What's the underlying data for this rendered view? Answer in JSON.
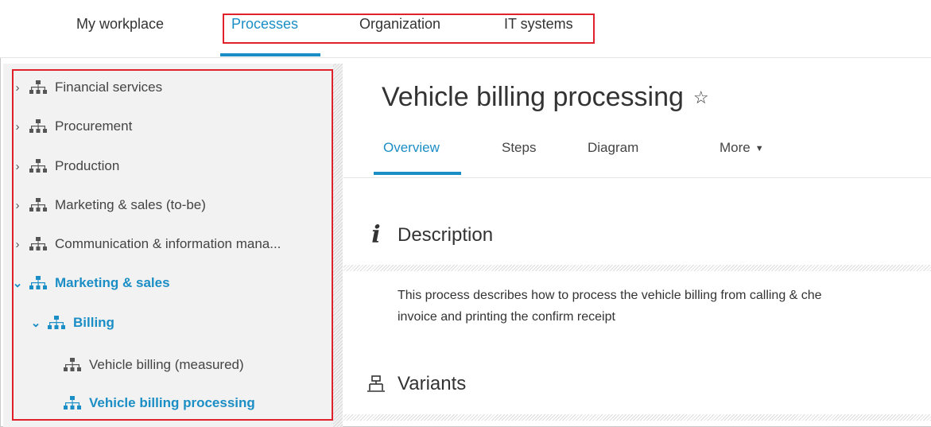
{
  "topnav": {
    "tabs": [
      "My workplace",
      "Processes",
      "Organization",
      "IT systems"
    ],
    "active": "Processes"
  },
  "sidebar": {
    "items": [
      {
        "label": "Financial services",
        "expanded": false
      },
      {
        "label": "Procurement",
        "expanded": false
      },
      {
        "label": "Production",
        "expanded": false
      },
      {
        "label": "Marketing & sales (to-be)",
        "expanded": false
      },
      {
        "label": "Communication & information mana...",
        "expanded": false
      },
      {
        "label": "Marketing & sales",
        "expanded": true
      },
      {
        "label": "Billing",
        "expanded": true
      },
      {
        "label": "Vehicle billing (measured)"
      },
      {
        "label": "Vehicle billing processing",
        "selected": true
      }
    ]
  },
  "main": {
    "title": "Vehicle billing processing",
    "tabs": [
      "Overview",
      "Steps",
      "Diagram",
      "More"
    ],
    "active_tab": "Overview",
    "description": {
      "heading": "Description",
      "text_line1": "This process describes how to process the vehicle billing from calling & che",
      "text_line2": "invoice and printing the confirm receipt"
    },
    "variants": {
      "heading": "Variants"
    }
  },
  "colors": {
    "accent": "#1b8ec5",
    "highlight": "#e0202a"
  },
  "icons": [
    "hierarchy-icon",
    "chevron-right-icon",
    "chevron-down-icon",
    "star-outline-icon",
    "info-icon",
    "variants-icon",
    "caret-down-icon"
  ]
}
